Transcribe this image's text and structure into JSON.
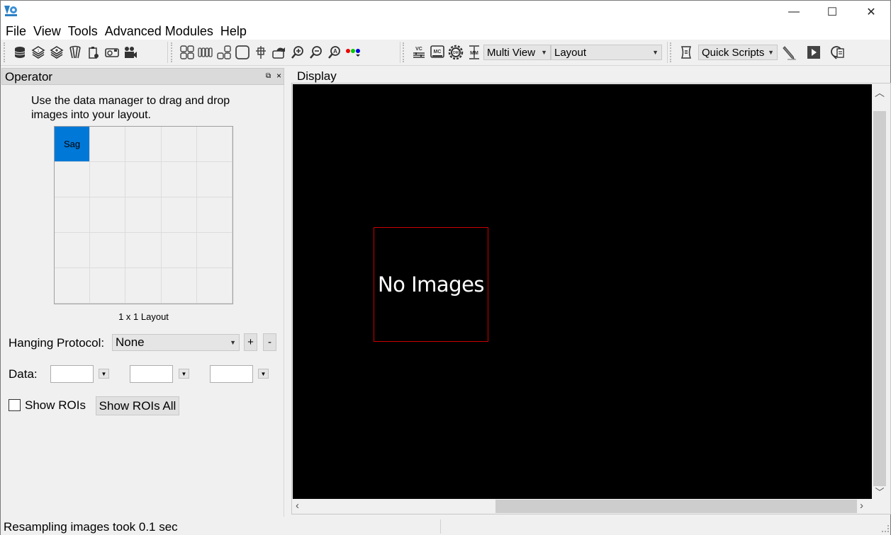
{
  "window": {
    "controls": {
      "minimize": "—",
      "maximize": "☐",
      "close": "✕"
    }
  },
  "menu": [
    "File",
    "View",
    "Tools",
    "Advanced Modules",
    "Help"
  ],
  "toolbar": {
    "group1_icons": [
      "database-icon",
      "layers-1-icon",
      "layers-plus-icon",
      "scan-icon",
      "clipboard-icon",
      "snapshot-icon",
      "video-camera-icon"
    ],
    "group2_icons": [
      "grid-2x2-icon",
      "columns-icon",
      "grid-step-icon",
      "single-view-icon",
      "crosshair-icon",
      "rotate-view-icon",
      "zoom-in-icon",
      "zoom-out-icon",
      "auto-zoom-icon",
      "color-channels-icon"
    ],
    "group3_icons": [
      "vc-icon",
      "mc-icon",
      "dm-icon",
      "mm-icon"
    ],
    "view_mode": "Multi View",
    "layout": "Layout",
    "quick_scripts": "Quick Scripts",
    "group4_icons": [
      "script-icon",
      "pencil-icon",
      "play-icon",
      "search-document-icon"
    ]
  },
  "operator": {
    "title": "Operator",
    "float_icon": "⧉",
    "close_icon": "×",
    "instructions": "Use the data manager to drag and drop images into your layout.",
    "grid_rows": 5,
    "grid_cols": 5,
    "selected_cell_label": "Sag",
    "layout_label": "1 x 1 Layout",
    "hanging_protocol_label": "Hanging Protocol:",
    "hanging_protocol_value": "None",
    "add_label": "+",
    "remove_label": "-",
    "data_label": "Data:",
    "data_fields": [
      "",
      "",
      ""
    ],
    "show_rois_label": "Show ROIs",
    "show_rois_checked": false,
    "show_rois_all_label": "Show ROIs All"
  },
  "display": {
    "title": "Display",
    "placeholder": "No Images",
    "box_color": "#cc0000"
  },
  "status": {
    "message": "Resampling images took 0.1 sec"
  }
}
